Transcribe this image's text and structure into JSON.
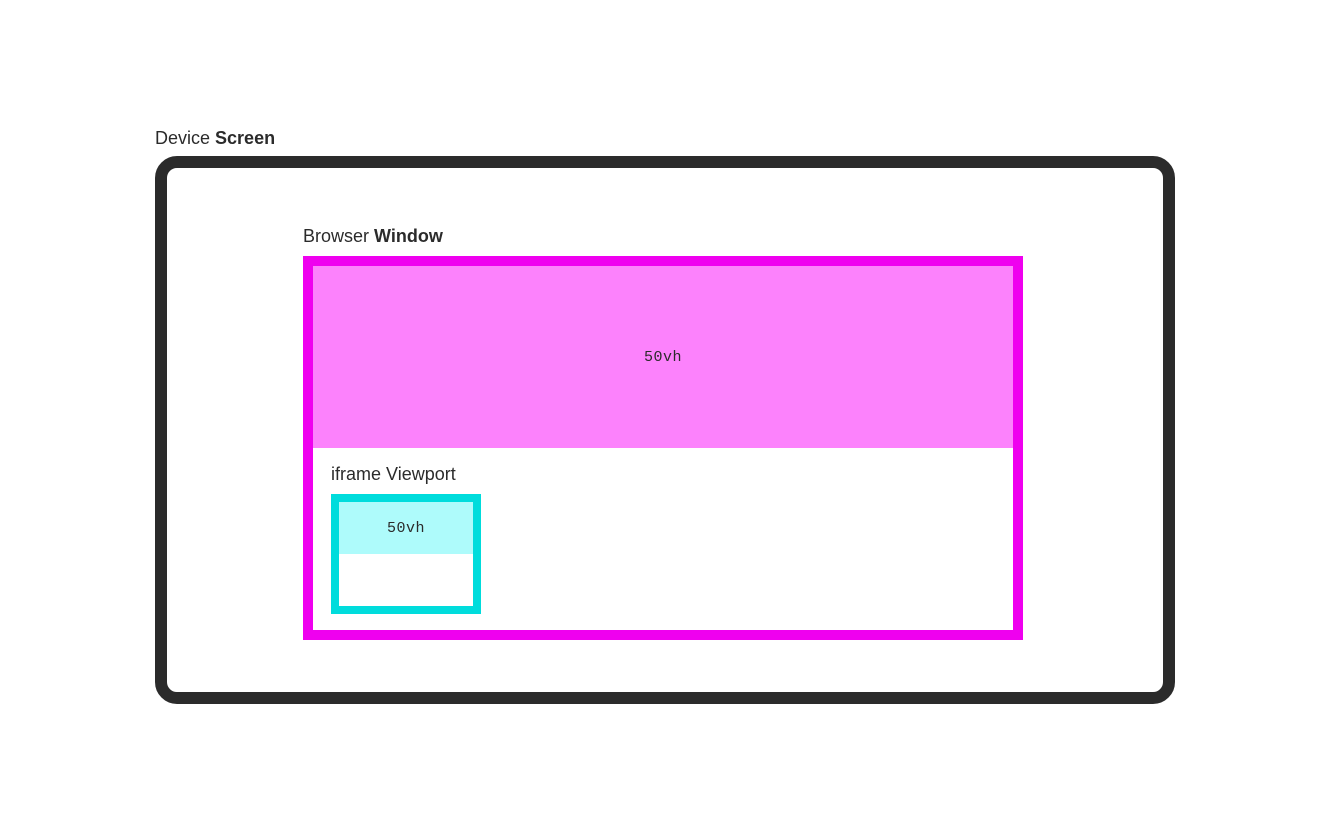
{
  "screen": {
    "label_prefix": "Device ",
    "label_bold": "Screen"
  },
  "window": {
    "label_prefix": "Browser ",
    "label_bold": "Window",
    "top_half_text": "50vh"
  },
  "iframe": {
    "label_prefix": "iframe ",
    "label_bold": "Viewport",
    "top_half_text": "50vh"
  },
  "colors": {
    "screen_border": "#2b2b2b",
    "window_border": "#ef00ef",
    "window_fill": "#fc82fc",
    "iframe_border": "#00dcdc",
    "iframe_fill": "#aefbfb"
  }
}
